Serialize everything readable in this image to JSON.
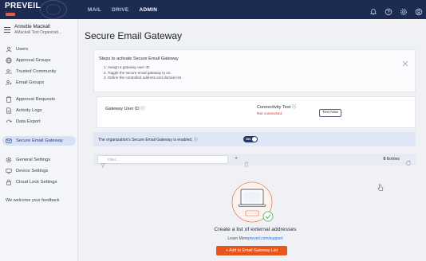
{
  "app": {
    "logo_text": "PREVEIL"
  },
  "nav": {
    "items": [
      {
        "label": "MAIL",
        "active": false
      },
      {
        "label": "DRIVE",
        "active": false
      },
      {
        "label": "ADMIN",
        "active": true
      }
    ]
  },
  "top_icons": [
    "bell-icon",
    "help-icon",
    "settings-icon",
    "account-icon"
  ],
  "user": {
    "name": "Annette Mackall",
    "org": "AMackall Test Organizati..."
  },
  "sidebar": {
    "items": [
      {
        "label": "Users",
        "icon": "user-icon",
        "active": false
      },
      {
        "label": "Approval Groups",
        "icon": "globe-icon",
        "active": false
      },
      {
        "label": "Trusted Community",
        "icon": "community-icon",
        "active": false
      },
      {
        "label": "Email Groups",
        "icon": "email-group-icon",
        "active": false
      },
      {
        "label": "Approval Requests",
        "icon": "clipboard-icon",
        "active": false
      },
      {
        "label": "Activity Logs",
        "icon": "log-icon",
        "active": false
      },
      {
        "label": "Data Export",
        "icon": "export-icon",
        "active": false
      },
      {
        "label": "Secure Email Gateway",
        "icon": "mail-icon",
        "active": true
      },
      {
        "label": "General Settings",
        "icon": "gear-icon",
        "active": false
      },
      {
        "label": "Device Settings",
        "icon": "monitor-icon",
        "active": false
      },
      {
        "label": "Cloud Lock Settings",
        "icon": "cloud-lock-icon",
        "active": false
      }
    ],
    "feedback": "We welcome your feedback"
  },
  "page": {
    "title": "Secure Email Gateway"
  },
  "steps": {
    "title": "Steps to activate Secure Email Gateway",
    "items": [
      "1. Assign a gateway user ID.",
      "2. Toggle the secure email gateway to on.",
      "3. Define the controlled address and domain list."
    ]
  },
  "gateway": {
    "user_id_label": "Gateway User ID ⓘ",
    "connectivity_label": "Connectivity Test ⓘ",
    "status": "Not connected.",
    "test_button": "Test Now"
  },
  "enable": {
    "text": "The organization's Secure Email Gateway is enabled. ⓘ",
    "toggle_label": "ON",
    "enabled": true
  },
  "filter": {
    "placeholder": "Filter...",
    "entries_count": "0",
    "entries_label": "Entries"
  },
  "empty": {
    "title": "Create a list of external addresses",
    "learn_more_prefix": "Learn More",
    "learn_more_link": "preveil.com/support",
    "add_button": "+ Add to Email Gateway List"
  },
  "colors": {
    "topbar": "#1d2a52",
    "accent": "#e8561c",
    "active_bg": "#d9e2f5",
    "error": "#d0312d",
    "link": "#2b6fd6"
  }
}
